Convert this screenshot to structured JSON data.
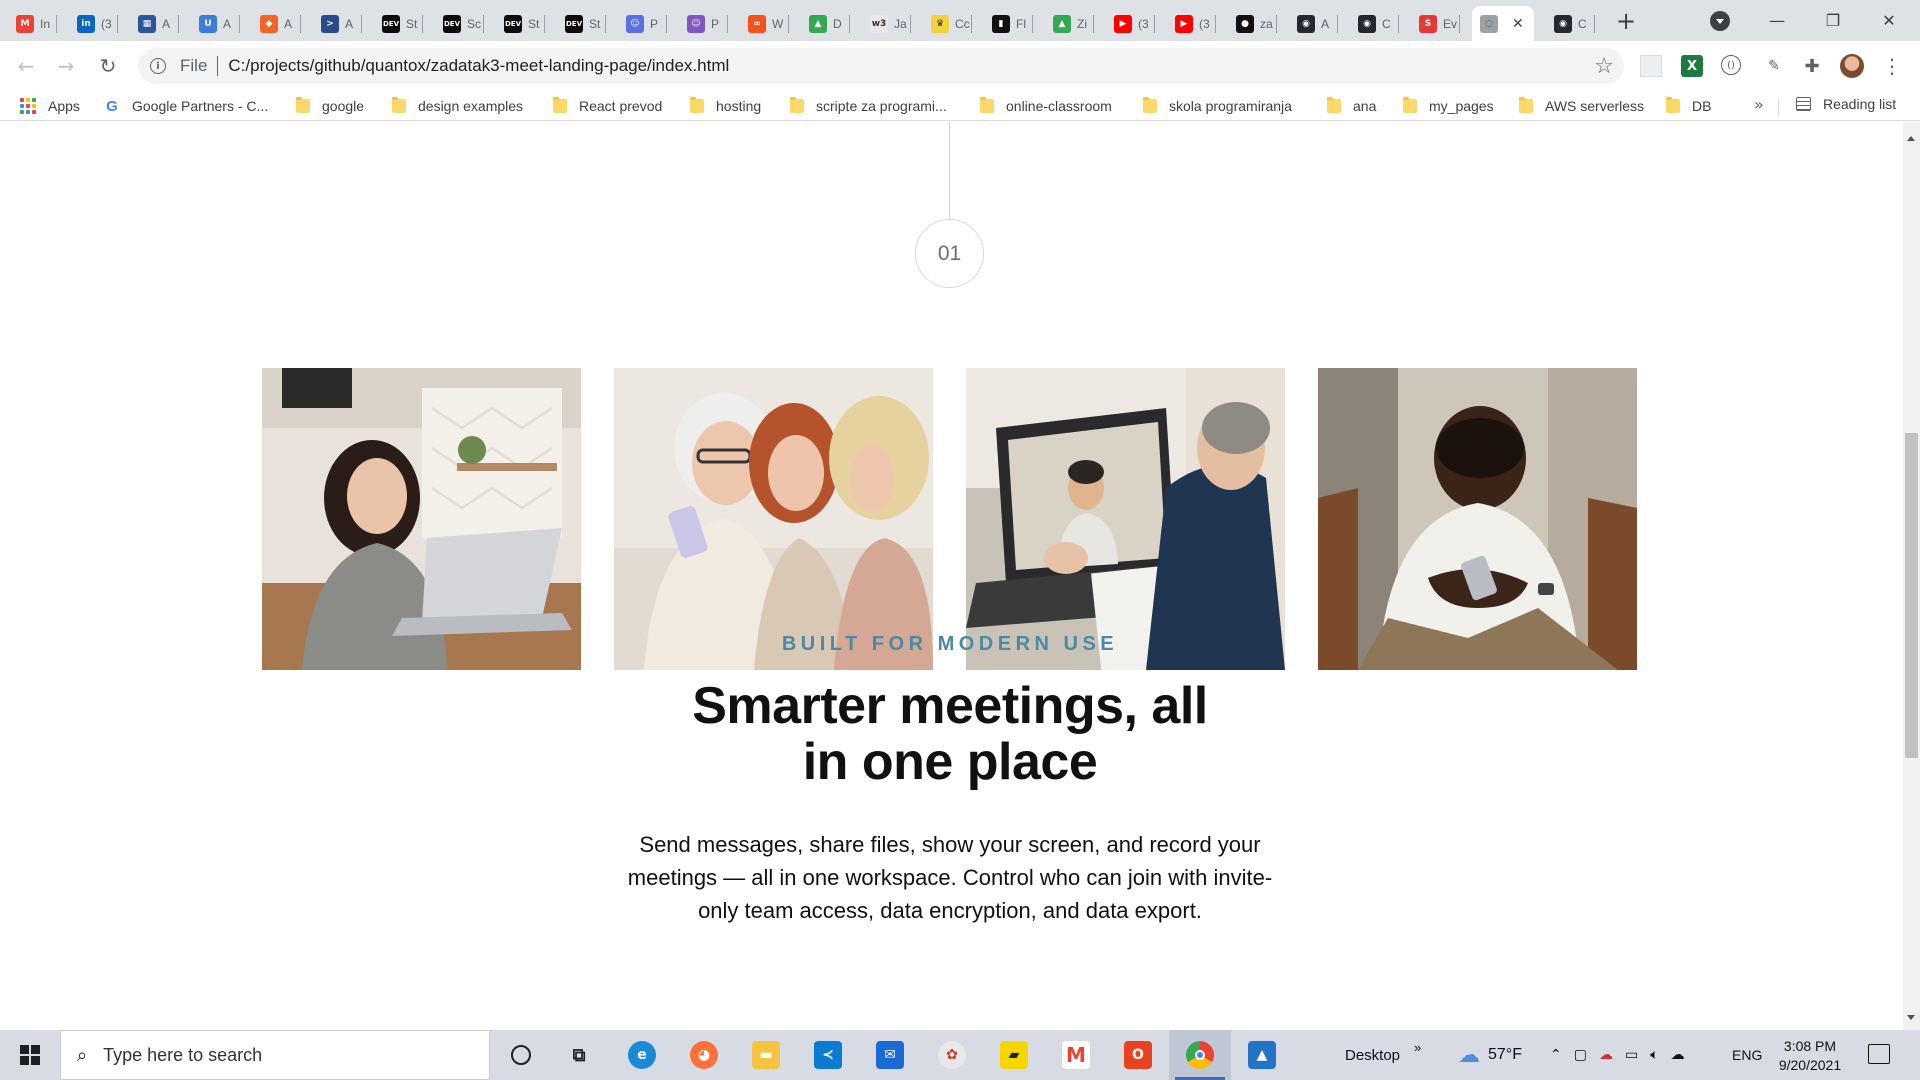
{
  "browser": {
    "tabs": [
      {
        "label": "In",
        "icon": "gmail-icon",
        "color": "#ea4335",
        "glyph": "M"
      },
      {
        "label": "(3",
        "icon": "linkedin-icon",
        "color": "#0a66c2",
        "glyph": "in"
      },
      {
        "label": "A",
        "icon": "calendar-icon",
        "color": "#2b579a",
        "glyph": "▦"
      },
      {
        "label": "A",
        "icon": "u-icon",
        "color": "#3b7dd8",
        "glyph": "U"
      },
      {
        "label": "A",
        "icon": "cube-icon",
        "color": "#f16529",
        "glyph": "◆"
      },
      {
        "label": "A",
        "icon": "powershell-icon",
        "color": "#2a4a8a",
        "glyph": ">"
      },
      {
        "label": "St",
        "icon": "dev-icon",
        "color": "#0a0a0a",
        "glyph": "DEV"
      },
      {
        "label": "Sc",
        "icon": "dev-icon",
        "color": "#0a0a0a",
        "glyph": "DEV"
      },
      {
        "label": "St",
        "icon": "dev-icon",
        "color": "#0a0a0a",
        "glyph": "DEV"
      },
      {
        "label": "St",
        "icon": "dev-icon",
        "color": "#0a0a0a",
        "glyph": "DEV"
      },
      {
        "label": "P",
        "icon": "robot-icon",
        "color": "#5a6ee8",
        "glyph": "☺"
      },
      {
        "label": "P",
        "icon": "robot-icon",
        "color": "#7e57c2",
        "glyph": "☺"
      },
      {
        "label": "W",
        "icon": "chain-icon",
        "color": "#f4511e",
        "glyph": "∞"
      },
      {
        "label": "D",
        "icon": "drive-icon",
        "color": "#34a853",
        "glyph": "▲"
      },
      {
        "label": "Ja",
        "icon": "w3schools-icon",
        "color": "#e8e8e8",
        "glyph": "w3"
      },
      {
        "label": "Cc",
        "icon": "crown-icon",
        "color": "#f4d03f",
        "glyph": "♛"
      },
      {
        "label": "Fl",
        "icon": "book-icon",
        "color": "#111111",
        "glyph": "▮"
      },
      {
        "label": "Zi",
        "icon": "drive-icon",
        "color": "#34a853",
        "glyph": "▲"
      },
      {
        "label": "(3",
        "icon": "youtube-icon",
        "color": "#ff0000",
        "glyph": "▶"
      },
      {
        "label": "(3",
        "icon": "youtube-icon",
        "color": "#ff0000",
        "glyph": "▶"
      },
      {
        "label": "za",
        "icon": "circle-logo-icon",
        "color": "#111111",
        "glyph": "●"
      },
      {
        "label": "A",
        "icon": "github-icon",
        "color": "#24292f",
        "glyph": "◉"
      },
      {
        "label": "C",
        "icon": "github-icon",
        "color": "#24292f",
        "glyph": "◉"
      },
      {
        "label": "Ev",
        "icon": "s-logo-icon",
        "color": "#e53935",
        "glyph": "S"
      },
      {
        "label": "",
        "icon": "loading-icon",
        "color": "#9aa0a6",
        "glyph": "◌"
      },
      {
        "label": "C",
        "icon": "github-icon",
        "color": "#24292f",
        "glyph": "◉"
      }
    ],
    "active_tab_index": 24,
    "address": {
      "scheme": "File",
      "url": "C:/projects/github/quantox/zadatak3-meet-landing-page/index.html"
    },
    "bookmarks": [
      {
        "label": "Apps",
        "type": "apps"
      },
      {
        "label": "Google Partners - C...",
        "type": "google"
      },
      {
        "label": "google",
        "type": "folder"
      },
      {
        "label": "design examples",
        "type": "folder"
      },
      {
        "label": "React prevod",
        "type": "folder"
      },
      {
        "label": "hosting",
        "type": "folder"
      },
      {
        "label": "scripte za programi...",
        "type": "folder"
      },
      {
        "label": "online-classroom",
        "type": "folder"
      },
      {
        "label": "skola programiranja",
        "type": "folder"
      },
      {
        "label": "ana",
        "type": "folder"
      },
      {
        "label": "my_pages",
        "type": "folder"
      },
      {
        "label": "AWS serverless",
        "type": "folder"
      },
      {
        "label": "DB",
        "type": "folder"
      }
    ],
    "bookmarks_more": "»",
    "reading_list": "Reading list"
  },
  "page": {
    "step_number": "01",
    "photos": [
      {
        "name": "woman-laptop-photo"
      },
      {
        "name": "women-phone-photo"
      },
      {
        "name": "video-call-photo"
      },
      {
        "name": "man-phone-photo"
      }
    ],
    "eyebrow": "BUILT FOR MODERN USE",
    "headline_line1": "Smarter meetings, all",
    "headline_line2": "in one place",
    "body": "Send messages, share files, show your screen, and record your meetings — all in one workspace. Control who can join with invite-only team access, data encryption, and data export."
  },
  "taskbar": {
    "search_placeholder": "Type here to search",
    "desktop_label": "Desktop",
    "desktop_chevron": "»",
    "weather": "57°F",
    "language": "ENG",
    "time": "3:08 PM",
    "date": "9/20/2021"
  }
}
